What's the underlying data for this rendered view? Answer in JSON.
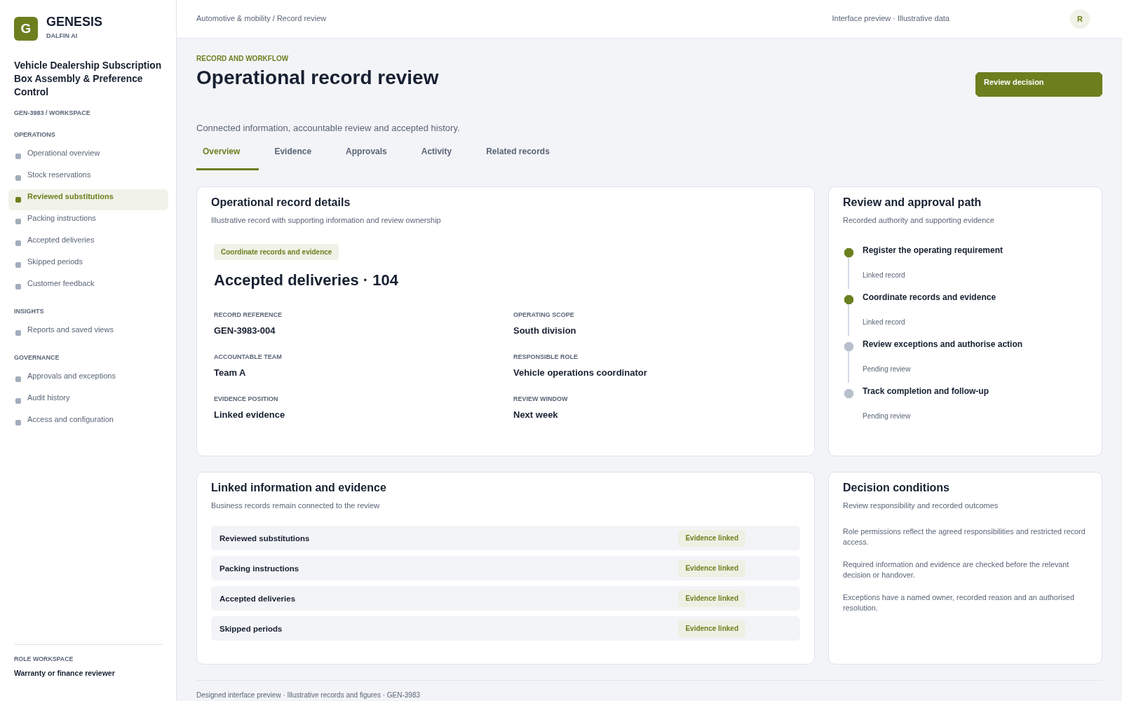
{
  "brand": {
    "logo": "G",
    "name": "GENESIS",
    "org": "DALFIN AI"
  },
  "sidebar": {
    "project_title": "Vehicle Dealership Subscription Box Assembly & Preference Control",
    "project_path": "GEN-3983 / WORKSPACE",
    "sections": [
      {
        "heading": "OPERATIONS",
        "items": [
          {
            "label": "Operational overview",
            "selected": false
          },
          {
            "label": "Stock reservations",
            "selected": false
          },
          {
            "label": "Reviewed substitutions",
            "selected": true
          },
          {
            "label": "Packing instructions",
            "selected": false
          },
          {
            "label": "Accepted deliveries",
            "selected": false
          },
          {
            "label": "Skipped periods",
            "selected": false
          },
          {
            "label": "Customer feedback",
            "selected": false
          }
        ]
      },
      {
        "heading": "INSIGHTS",
        "items": [
          {
            "label": "Reports and saved views",
            "selected": false
          }
        ]
      },
      {
        "heading": "GOVERNANCE",
        "items": [
          {
            "label": "Approvals and exceptions",
            "selected": false
          },
          {
            "label": "Audit history",
            "selected": false
          },
          {
            "label": "Access and configuration",
            "selected": false
          }
        ]
      }
    ],
    "role": {
      "label": "ROLE WORKSPACE",
      "value": "Warranty or finance reviewer"
    }
  },
  "header": {
    "breadcrumb": "Automotive & mobility / Record review",
    "note": "Interface preview · Illustrative data",
    "avatar": "R"
  },
  "page": {
    "eyebrow": "RECORD AND WORKFLOW",
    "title": "Operational record review",
    "action": "Review decision",
    "subtitle": "Connected information, accountable review and accepted history."
  },
  "tabs": [
    {
      "label": "Overview",
      "selected": true
    },
    {
      "label": "Evidence",
      "selected": false
    },
    {
      "label": "Approvals",
      "selected": false
    },
    {
      "label": "Activity",
      "selected": false
    },
    {
      "label": "Related records",
      "selected": false
    }
  ],
  "record_details": {
    "title": "Operational record details",
    "subtitle": "Illustrative record with supporting information and review ownership",
    "tag": "Coordinate records and evidence",
    "headline": "Accepted deliveries · 104",
    "fields": [
      {
        "label": "RECORD REFERENCE",
        "value": "GEN-3983-004"
      },
      {
        "label": "OPERATING SCOPE",
        "value": "South division"
      },
      {
        "label": "ACCOUNTABLE TEAM",
        "value": "Team A"
      },
      {
        "label": "RESPONSIBLE ROLE",
        "value": "Vehicle operations coordinator"
      },
      {
        "label": "EVIDENCE POSITION",
        "value": "Linked evidence"
      },
      {
        "label": "REVIEW WINDOW",
        "value": "Next week"
      }
    ]
  },
  "approval_path": {
    "title": "Review and approval path",
    "subtitle": "Recorded authority and supporting evidence",
    "steps": [
      {
        "title": "Register the operating requirement",
        "note": "Linked record",
        "done": true
      },
      {
        "title": "Coordinate records and evidence",
        "note": "Linked record",
        "done": true
      },
      {
        "title": "Review exceptions and authorise action",
        "note": "Pending review",
        "done": false
      },
      {
        "title": "Track completion and follow-up",
        "note": "Pending review",
        "done": false
      }
    ]
  },
  "linked_information": {
    "title": "Linked information and evidence",
    "subtitle": "Business records remain connected to the review",
    "rows": [
      {
        "label": "Reviewed substitutions",
        "status": "Evidence linked"
      },
      {
        "label": "Packing instructions",
        "status": "Evidence linked"
      },
      {
        "label": "Accepted deliveries",
        "status": "Evidence linked"
      },
      {
        "label": "Skipped periods",
        "status": "Evidence linked"
      }
    ]
  },
  "decision_conditions": {
    "title": "Decision conditions",
    "subtitle": "Review responsibility and recorded outcomes",
    "items": [
      "Role permissions reflect the agreed responsibilities and restricted record access.",
      "Required information and evidence are checked before the relevant decision or handover.",
      "Exceptions have a named owner, recorded reason and an authorised resolution."
    ]
  },
  "footer": "Designed interface preview · Illustrative records and figures · GEN-3983"
}
